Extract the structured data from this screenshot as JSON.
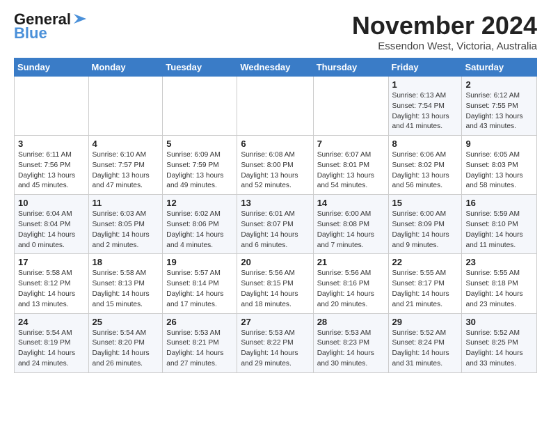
{
  "header": {
    "logo_general": "General",
    "logo_blue": "Blue",
    "month": "November 2024",
    "location": "Essendon West, Victoria, Australia"
  },
  "weekdays": [
    "Sunday",
    "Monday",
    "Tuesday",
    "Wednesday",
    "Thursday",
    "Friday",
    "Saturday"
  ],
  "weeks": [
    [
      {
        "day": "",
        "info": ""
      },
      {
        "day": "",
        "info": ""
      },
      {
        "day": "",
        "info": ""
      },
      {
        "day": "",
        "info": ""
      },
      {
        "day": "",
        "info": ""
      },
      {
        "day": "1",
        "info": "Sunrise: 6:13 AM\nSunset: 7:54 PM\nDaylight: 13 hours\nand 41 minutes."
      },
      {
        "day": "2",
        "info": "Sunrise: 6:12 AM\nSunset: 7:55 PM\nDaylight: 13 hours\nand 43 minutes."
      }
    ],
    [
      {
        "day": "3",
        "info": "Sunrise: 6:11 AM\nSunset: 7:56 PM\nDaylight: 13 hours\nand 45 minutes."
      },
      {
        "day": "4",
        "info": "Sunrise: 6:10 AM\nSunset: 7:57 PM\nDaylight: 13 hours\nand 47 minutes."
      },
      {
        "day": "5",
        "info": "Sunrise: 6:09 AM\nSunset: 7:59 PM\nDaylight: 13 hours\nand 49 minutes."
      },
      {
        "day": "6",
        "info": "Sunrise: 6:08 AM\nSunset: 8:00 PM\nDaylight: 13 hours\nand 52 minutes."
      },
      {
        "day": "7",
        "info": "Sunrise: 6:07 AM\nSunset: 8:01 PM\nDaylight: 13 hours\nand 54 minutes."
      },
      {
        "day": "8",
        "info": "Sunrise: 6:06 AM\nSunset: 8:02 PM\nDaylight: 13 hours\nand 56 minutes."
      },
      {
        "day": "9",
        "info": "Sunrise: 6:05 AM\nSunset: 8:03 PM\nDaylight: 13 hours\nand 58 minutes."
      }
    ],
    [
      {
        "day": "10",
        "info": "Sunrise: 6:04 AM\nSunset: 8:04 PM\nDaylight: 14 hours\nand 0 minutes."
      },
      {
        "day": "11",
        "info": "Sunrise: 6:03 AM\nSunset: 8:05 PM\nDaylight: 14 hours\nand 2 minutes."
      },
      {
        "day": "12",
        "info": "Sunrise: 6:02 AM\nSunset: 8:06 PM\nDaylight: 14 hours\nand 4 minutes."
      },
      {
        "day": "13",
        "info": "Sunrise: 6:01 AM\nSunset: 8:07 PM\nDaylight: 14 hours\nand 6 minutes."
      },
      {
        "day": "14",
        "info": "Sunrise: 6:00 AM\nSunset: 8:08 PM\nDaylight: 14 hours\nand 7 minutes."
      },
      {
        "day": "15",
        "info": "Sunrise: 6:00 AM\nSunset: 8:09 PM\nDaylight: 14 hours\nand 9 minutes."
      },
      {
        "day": "16",
        "info": "Sunrise: 5:59 AM\nSunset: 8:10 PM\nDaylight: 14 hours\nand 11 minutes."
      }
    ],
    [
      {
        "day": "17",
        "info": "Sunrise: 5:58 AM\nSunset: 8:12 PM\nDaylight: 14 hours\nand 13 minutes."
      },
      {
        "day": "18",
        "info": "Sunrise: 5:58 AM\nSunset: 8:13 PM\nDaylight: 14 hours\nand 15 minutes."
      },
      {
        "day": "19",
        "info": "Sunrise: 5:57 AM\nSunset: 8:14 PM\nDaylight: 14 hours\nand 17 minutes."
      },
      {
        "day": "20",
        "info": "Sunrise: 5:56 AM\nSunset: 8:15 PM\nDaylight: 14 hours\nand 18 minutes."
      },
      {
        "day": "21",
        "info": "Sunrise: 5:56 AM\nSunset: 8:16 PM\nDaylight: 14 hours\nand 20 minutes."
      },
      {
        "day": "22",
        "info": "Sunrise: 5:55 AM\nSunset: 8:17 PM\nDaylight: 14 hours\nand 21 minutes."
      },
      {
        "day": "23",
        "info": "Sunrise: 5:55 AM\nSunset: 8:18 PM\nDaylight: 14 hours\nand 23 minutes."
      }
    ],
    [
      {
        "day": "24",
        "info": "Sunrise: 5:54 AM\nSunset: 8:19 PM\nDaylight: 14 hours\nand 24 minutes."
      },
      {
        "day": "25",
        "info": "Sunrise: 5:54 AM\nSunset: 8:20 PM\nDaylight: 14 hours\nand 26 minutes."
      },
      {
        "day": "26",
        "info": "Sunrise: 5:53 AM\nSunset: 8:21 PM\nDaylight: 14 hours\nand 27 minutes."
      },
      {
        "day": "27",
        "info": "Sunrise: 5:53 AM\nSunset: 8:22 PM\nDaylight: 14 hours\nand 29 minutes."
      },
      {
        "day": "28",
        "info": "Sunrise: 5:53 AM\nSunset: 8:23 PM\nDaylight: 14 hours\nand 30 minutes."
      },
      {
        "day": "29",
        "info": "Sunrise: 5:52 AM\nSunset: 8:24 PM\nDaylight: 14 hours\nand 31 minutes."
      },
      {
        "day": "30",
        "info": "Sunrise: 5:52 AM\nSunset: 8:25 PM\nDaylight: 14 hours\nand 33 minutes."
      }
    ]
  ]
}
